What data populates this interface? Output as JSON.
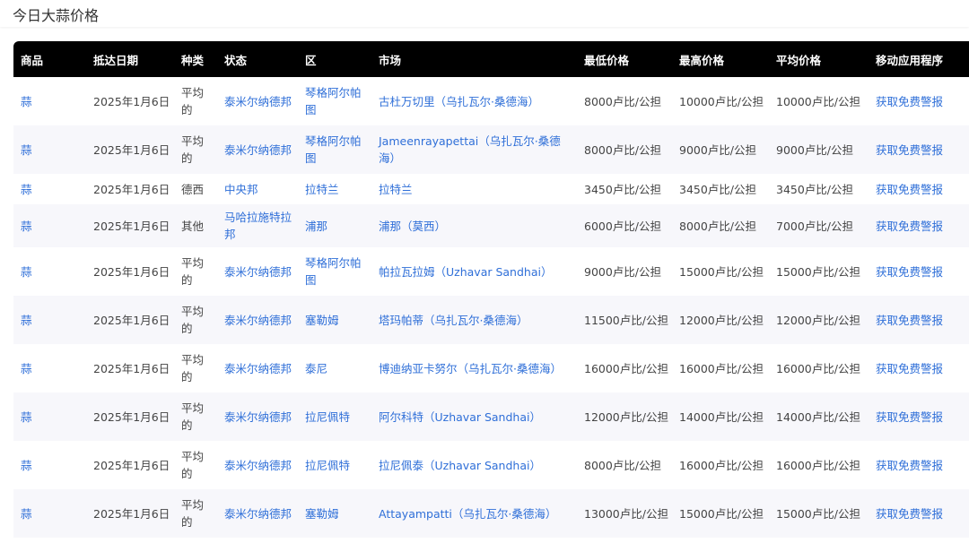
{
  "page": {
    "title": "今日大蒜价格"
  },
  "table": {
    "headers": [
      "商品",
      "抵达日期",
      "种类",
      "状态",
      "区",
      "市场",
      "最低价格",
      "最高价格",
      "平均价格",
      "移动应用程序"
    ],
    "rows": [
      [
        "蒜",
        "2025年1月6日",
        "平均的",
        "泰米尔纳德邦",
        "琴格阿尔帕图",
        "古杜万切里（乌扎瓦尔·桑德海）",
        "8000卢比/公担",
        "10000卢比/公担",
        "10000卢比/公担",
        "获取免费警报"
      ],
      [
        "蒜",
        "2025年1月6日",
        "平均的",
        "泰米尔纳德邦",
        "琴格阿尔帕图",
        "Jameenrayapettai（乌扎瓦尔·桑德海）",
        "8000卢比/公担",
        "9000卢比/公担",
        "9000卢比/公担",
        "获取免费警报"
      ],
      [
        "蒜",
        "2025年1月6日",
        "德西",
        "中央邦",
        "拉特兰",
        "拉特兰",
        "3450卢比/公担",
        "3450卢比/公担",
        "3450卢比/公担",
        "获取免费警报"
      ],
      [
        "蒜",
        "2025年1月6日",
        "其他",
        "马哈拉施特拉邦",
        "浦那",
        "浦那（莫西）",
        "6000卢比/公担",
        "8000卢比/公担",
        "7000卢比/公担",
        "获取免费警报"
      ],
      [
        "蒜",
        "2025年1月6日",
        "平均的",
        "泰米尔纳德邦",
        "琴格阿尔帕图",
        "帕拉瓦拉姆（Uzhavar Sandhai）",
        "9000卢比/公担",
        "15000卢比/公担",
        "15000卢比/公担",
        "获取免费警报"
      ],
      [
        "蒜",
        "2025年1月6日",
        "平均的",
        "泰米尔纳德邦",
        "塞勒姆",
        "塔玛帕蒂（乌扎瓦尔·桑德海）",
        "11500卢比/公担",
        "12000卢比/公担",
        "12000卢比/公担",
        "获取免费警报"
      ],
      [
        "蒜",
        "2025年1月6日",
        "平均的",
        "泰米尔纳德邦",
        "泰尼",
        "博迪纳亚卡努尔（乌扎瓦尔·桑德海）",
        "16000卢比/公担",
        "16000卢比/公担",
        "16000卢比/公担",
        "获取免费警报"
      ],
      [
        "蒜",
        "2025年1月6日",
        "平均的",
        "泰米尔纳德邦",
        "拉尼佩特",
        "阿尔科特（Uzhavar Sandhai）",
        "12000卢比/公担",
        "14000卢比/公担",
        "14000卢比/公担",
        "获取免费警报"
      ],
      [
        "蒜",
        "2025年1月6日",
        "平均的",
        "泰米尔纳德邦",
        "拉尼佩特",
        "拉尼佩泰（Uzhavar Sandhai）",
        "8000卢比/公担",
        "16000卢比/公担",
        "16000卢比/公担",
        "获取免费警报"
      ],
      [
        "蒜",
        "2025年1月6日",
        "平均的",
        "泰米尔纳德邦",
        "塞勒姆",
        "Attayampatti（乌扎瓦尔·桑德海）",
        "13000卢比/公担",
        "15000卢比/公担",
        "15000卢比/公担",
        "获取免费警报"
      ]
    ]
  },
  "colors": {
    "header_bg": "#000000",
    "header_text": "#ffffff",
    "link": "#2f6fd8",
    "text": "#444444",
    "row_alt": "#f7f7fb"
  }
}
